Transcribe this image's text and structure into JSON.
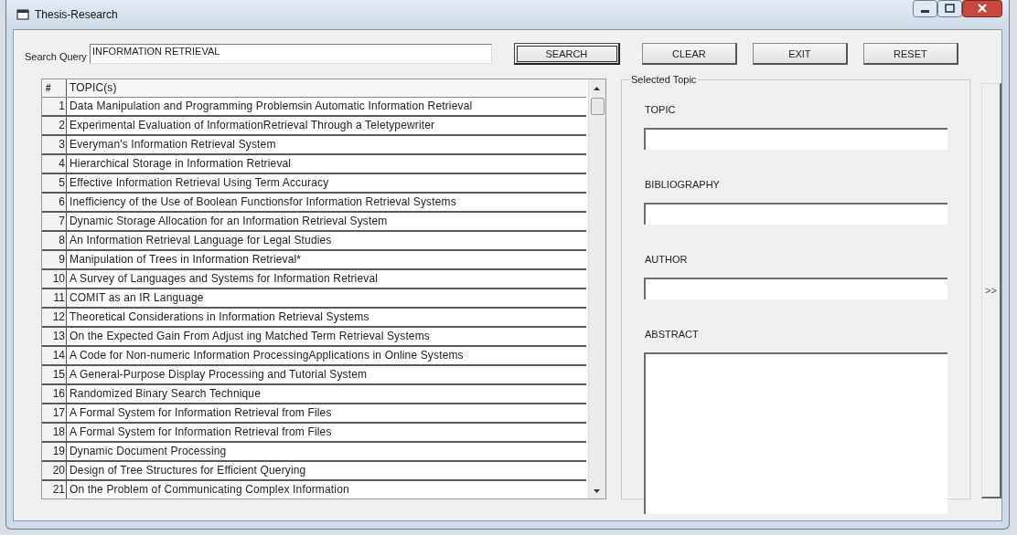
{
  "window": {
    "title": "Thesis-Research"
  },
  "search": {
    "label": "Search Query",
    "value": "INFORMATION RETRIEVAL"
  },
  "buttons": [
    {
      "label": "SEARCH",
      "default": true
    },
    {
      "label": "CLEAR",
      "default": false
    },
    {
      "label": "EXIT",
      "default": false
    },
    {
      "label": "RESET",
      "default": false
    }
  ],
  "table": {
    "columns": [
      "#",
      "TOPIC(s)"
    ],
    "rows": [
      {
        "number": "1",
        "topic": "Data Manipulation and Programming Problemsin Automatic Information Retrieval"
      },
      {
        "number": "2",
        "topic": "Experimental Evaluation of InformationRetrieval Through a Teletypewriter"
      },
      {
        "number": "3",
        "topic": "Everyman's Information Retrieval System"
      },
      {
        "number": "4",
        "topic": "Hierarchical Storage in Information Retrieval"
      },
      {
        "number": "5",
        "topic": "Effective Information Retrieval Using Term Accuracy"
      },
      {
        "number": "6",
        "topic": "Inefficiency of the Use of Boolean Functionsfor Information Retrieval Systems"
      },
      {
        "number": "7",
        "topic": "Dynamic Storage Allocation for an Information Retrieval System"
      },
      {
        "number": "8",
        "topic": "An Information Retrieval Language for Legal Studies"
      },
      {
        "number": "9",
        "topic": "Manipulation of Trees in Information Retrieval*"
      },
      {
        "number": "10",
        "topic": "A Survey of Languages and Systems for Information Retrieval"
      },
      {
        "number": "11",
        "topic": "COMIT as an IR Language"
      },
      {
        "number": "12",
        "topic": "Theoretical Considerations in Information Retrieval Systems"
      },
      {
        "number": "13",
        "topic": "On the Expected Gain From Adjust ing Matched Term Retrieval Systems"
      },
      {
        "number": "14",
        "topic": "A Code for Non-numeric Information ProcessingApplications in Online Systems"
      },
      {
        "number": "15",
        "topic": "A General-Purpose Display Processing and Tutorial System"
      },
      {
        "number": "16",
        "topic": "Randomized Binary Search Technique"
      },
      {
        "number": "17",
        "topic": "A Formal System for Information Retrieval from Files"
      },
      {
        "number": "18",
        "topic": "A Formal System for Information Retrieval from Files"
      },
      {
        "number": "19",
        "topic": "Dynamic Document Processing"
      },
      {
        "number": "20",
        "topic": "Design of Tree Structures for Efficient Querying"
      },
      {
        "number": "21",
        "topic": "On the Problem of Communicating Complex Information"
      }
    ]
  },
  "selected_topic": {
    "title": "Selected Topic",
    "fields": [
      {
        "label": "TOPIC",
        "kind": "line"
      },
      {
        "label": "BIBLIOGRAPHY",
        "kind": "line"
      },
      {
        "label": "AUTHOR",
        "kind": "line"
      },
      {
        "label": "ABSTRACT",
        "kind": "multiline"
      }
    ]
  },
  "side_button": {
    "label": ">>"
  }
}
